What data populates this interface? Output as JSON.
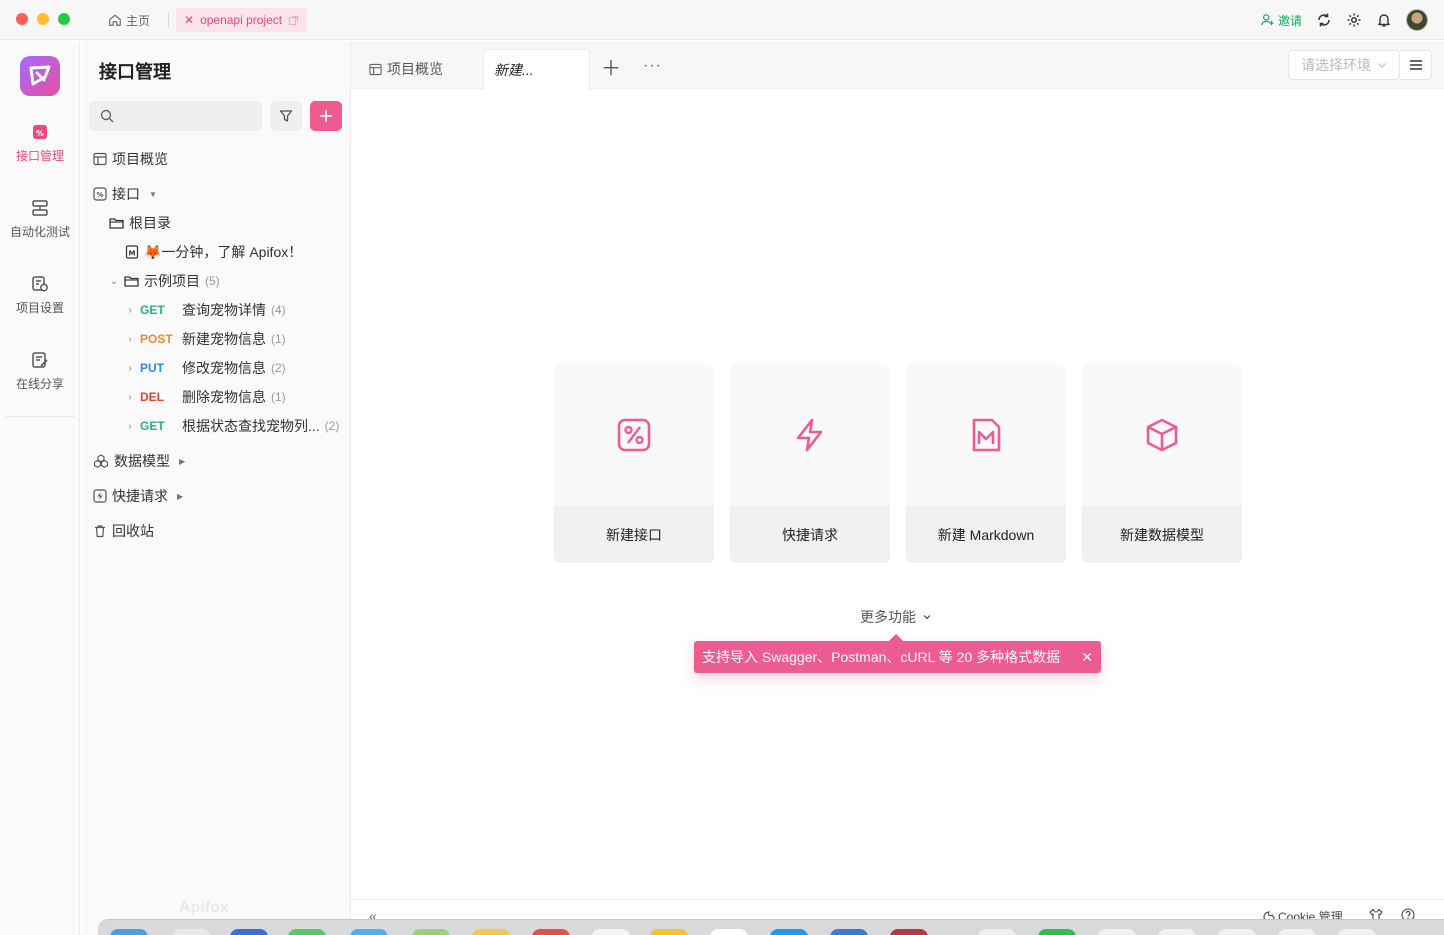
{
  "titlebar": {
    "home_label": "主页",
    "project_tab_label": "openapi project",
    "invite_label": "邀请"
  },
  "rail": {
    "items": [
      {
        "label": "接口管理",
        "icon": "api-icon",
        "active": true
      },
      {
        "label": "自动化测试",
        "icon": "test-icon",
        "active": false
      },
      {
        "label": "项目设置",
        "icon": "settings-icon",
        "active": false
      },
      {
        "label": "在线分享",
        "icon": "share-icon",
        "active": false
      }
    ]
  },
  "sidebar": {
    "title": "接口管理",
    "search_placeholder": "",
    "overview_label": "项目概览",
    "api_label": "接口",
    "root_folder": "根目录",
    "intro_doc": "🦊一分钟，了解 Apifox！",
    "example_folder": "示例项目",
    "example_count": "(5)",
    "endpoints": [
      {
        "method": "GET",
        "name": "查询宠物详情",
        "count": "(4)"
      },
      {
        "method": "POST",
        "name": "新建宠物信息",
        "count": "(1)"
      },
      {
        "method": "PUT",
        "name": "修改宠物信息",
        "count": "(2)"
      },
      {
        "method": "DEL",
        "name": "删除宠物信息",
        "count": "(1)"
      },
      {
        "method": "GET",
        "name": "根据状态查找宠物列...",
        "count": "(2)"
      }
    ],
    "data_model_label": "数据模型",
    "quick_request_label": "快捷请求",
    "recycle_label": "回收站",
    "watermark": "Apifox"
  },
  "tabs": {
    "overview_label": "项目概览",
    "new_label": "新建...",
    "env_placeholder": "请选择环境"
  },
  "cards": [
    {
      "label": "新建接口",
      "icon": "api-icon"
    },
    {
      "label": "快捷请求",
      "icon": "lightning-icon"
    },
    {
      "label": "新建 Markdown",
      "icon": "markdown-icon"
    },
    {
      "label": "新建数据模型",
      "icon": "cube-icon"
    }
  ],
  "more_functions_label": "更多功能",
  "tip_text": "支持导入 Swagger、Postman、cURL 等 20 多种格式数据",
  "bottombar": {
    "cookie_label": "Cookie 管理"
  },
  "colors": {
    "accent": "#ec5c90",
    "get": "#27b37b",
    "post": "#f08a2a",
    "put": "#2f8ae5",
    "del": "#e3442e"
  }
}
